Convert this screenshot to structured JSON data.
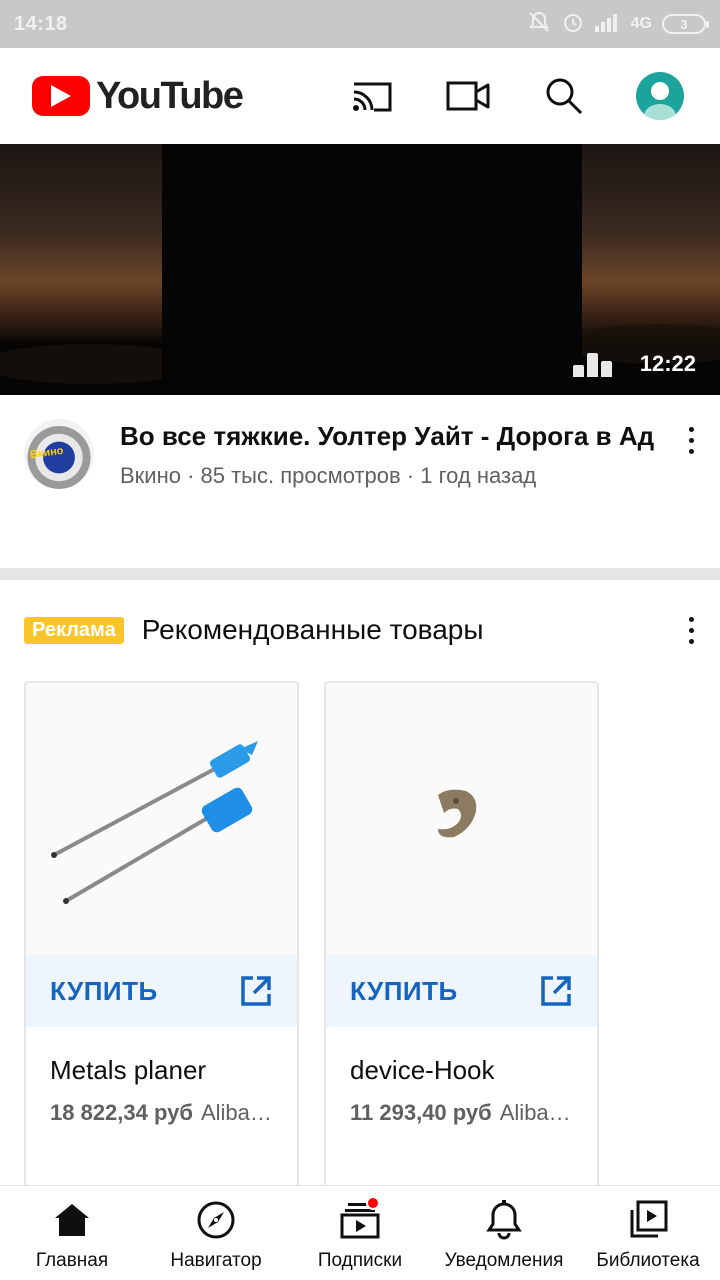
{
  "status_bar": {
    "time": "14:18",
    "network": "4G",
    "battery": "3"
  },
  "app_bar": {
    "logo_text": "YouTube",
    "icons": [
      "cast-icon",
      "video-camera-icon",
      "search-icon",
      "account-avatar"
    ]
  },
  "video": {
    "duration": "12:22",
    "title": "Во все тяжкие. Уолтер Уайт - Дорога в Ад",
    "meta": "Вкино · 85 тыс. просмотров · 1 год назад"
  },
  "ad": {
    "badge": "Реклама",
    "title": "Рекомендованные товары",
    "products": [
      {
        "buy_label": "КУПИТЬ",
        "name": "Metals planer",
        "price": "18 822,34 руб",
        "merchant": "Alibaba"
      },
      {
        "buy_label": "КУПИТЬ",
        "name": "device-Hook",
        "price": "11 293,40 руб",
        "merchant": "Alibaba"
      }
    ]
  },
  "bottom_nav": {
    "items": [
      {
        "label": "Главная",
        "icon": "home-icon"
      },
      {
        "label": "Навигатор",
        "icon": "compass-icon"
      },
      {
        "label": "Подписки",
        "icon": "subscriptions-icon",
        "has_notification_dot": true
      },
      {
        "label": "Уведомления",
        "icon": "bell-icon"
      },
      {
        "label": "Библиотека",
        "icon": "library-icon"
      }
    ]
  },
  "colors": {
    "brand_red": "#ff0000",
    "ad_badge": "#f9c52b",
    "buy_blue": "#1565c0",
    "avatar_teal": "#1ba39c"
  }
}
